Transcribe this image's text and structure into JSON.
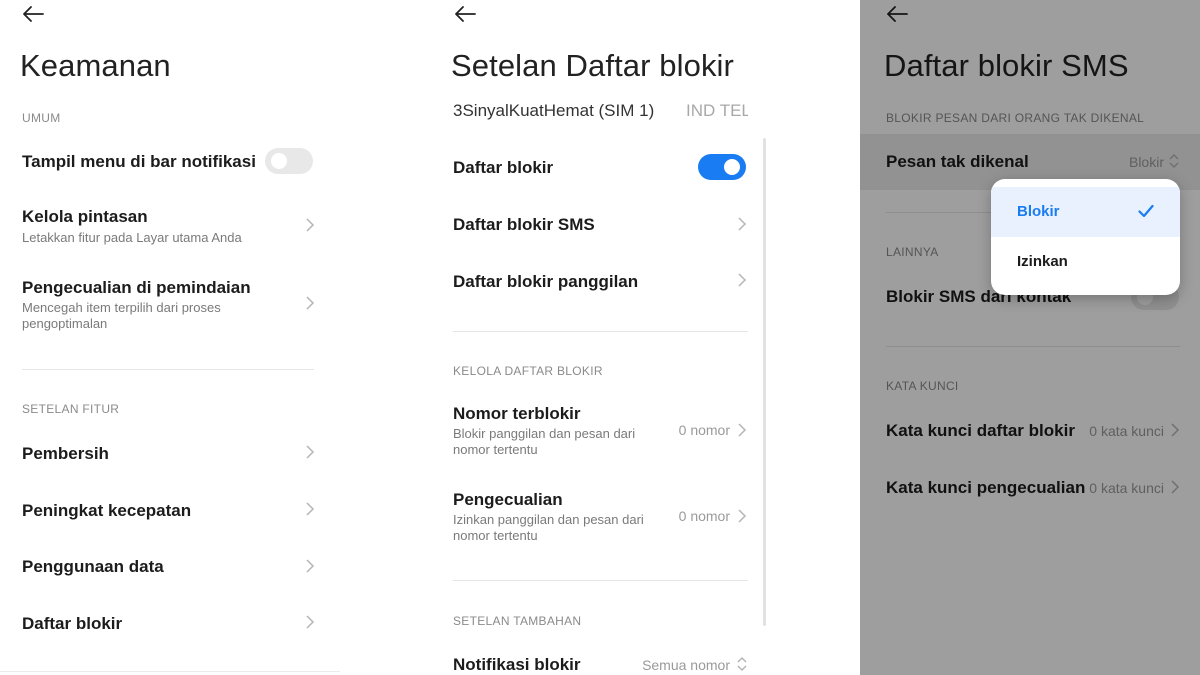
{
  "keamanan": {
    "title": "Keamanan",
    "section_umum": "UMUM",
    "notif_menu": "Tampil menu di bar notifikasi",
    "notif_toggle_on": false,
    "shortcuts_title": "Kelola pintasan",
    "shortcuts_sub": "Letakkan fitur pada Layar utama Anda",
    "scan_exceptions_title": "Pengecualian di pemindaian",
    "scan_exceptions_sub": "Mencegah item terpilih dari proses pengoptimalan",
    "section_fitur": "SETELAN FITUR",
    "cleaner": "Pembersih",
    "booster": "Peningkat kecepatan",
    "data_usage": "Penggunaan data",
    "blocklist": "Daftar blokir"
  },
  "blocklist_settings": {
    "title": "Setelan Daftar blokir",
    "sim_tabs": [
      "3SinyalKuatHemat (SIM 1)",
      "IND TEL"
    ],
    "blocklist_toggle_label": "Daftar blokir",
    "blocklist_toggle_on": true,
    "sms_blocklist": "Daftar blokir SMS",
    "call_blocklist": "Daftar blokir panggilan",
    "section_manage": "KELOLA DAFTAR BLOKIR",
    "blocked_numbers_title": "Nomor terblokir",
    "blocked_numbers_sub": "Blokir panggilan dan pesan dari nomor tertentu",
    "blocked_numbers_value": "0 nomor",
    "exceptions_title": "Pengecualian",
    "exceptions_sub": "Izinkan panggilan dan pesan dari nomor tertentu",
    "exceptions_value": "0 nomor",
    "section_extra": "SETELAN TAMBAHAN",
    "block_notif_title": "Notifikasi blokir",
    "block_notif_value": "Semua nomor"
  },
  "sms_blocklist": {
    "title": "Daftar blokir SMS",
    "section_unknown": "BLOKIR PESAN DARI ORANG TAK DIKENAL",
    "unknown_msgs_title": "Pesan tak dikenal",
    "unknown_msgs_value": "Blokir",
    "section_other": "LAINNYA",
    "block_contacts_title": "Blokir SMS dari kontak",
    "section_keywords": "KATA KUNCI",
    "keyword_blocklist_title": "Kata kunci daftar blokir",
    "keyword_blocklist_value": "0 kata kunci",
    "keyword_exceptions_title": "Kata kunci pengecualian",
    "keyword_exceptions_value": "0 kata kunci",
    "dropdown_options": [
      "Blokir",
      "Izinkan"
    ],
    "dropdown_selected": "Blokir"
  },
  "colors": {
    "accent": "#1a7cf2",
    "toggle_off": "#e8e8e8",
    "dropdown_selected_bg": "#e8f1fd"
  },
  "icons": {
    "back": "back-arrow-icon",
    "chevron": "chevron-right-icon",
    "updown": "chevron-up-down-icon",
    "check": "checkmark-icon"
  }
}
